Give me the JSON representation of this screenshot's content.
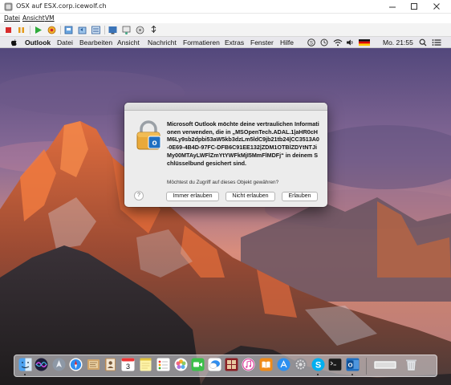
{
  "window": {
    "title": "OSX auf ESX.corp.icewolf.ch",
    "menus": [
      "Datei",
      "Ansicht",
      "VM"
    ]
  },
  "mac_menubar": {
    "apple_icon": "apple-icon",
    "app_name": "Outlook",
    "items": [
      "Datei",
      "Bearbeiten",
      "Ansicht",
      "Nachricht",
      "Formatieren",
      "Extras",
      "Fenster",
      "Hilfe"
    ],
    "clock": "Mo. 21:55"
  },
  "dialog": {
    "message": "Microsoft Outlook möchte deine vertraulichen Informationen verwenden, die in „MSOpenTech.ADAL.1|aHR0cHM6Ly9sb2dpbi53aW5kb3dzLm5ldC9jb21tb24|CC3513A0-0E69-4B4D-97FC-DFB6C91EE132|ZDM1OTBlZDYtNTJiMy00MTAyLWFlZmYtYWFkMjI5MmFlMDFj“ in deinem Schlüsselbund gesichert sind.",
    "question": "Möchtest du Zugriff auf dieses Objekt gewähren?",
    "help": "?",
    "buttons": {
      "always": "Immer erlauben",
      "deny": "Nicht erlauben",
      "allow": "Erlauben"
    }
  },
  "colors": {
    "sky_top": "#5a4e86",
    "sky_glow": "#f09a6a",
    "mountain_lit": "#e2683a",
    "mountain_dark": "#2a2422"
  },
  "dock_icons": [
    "finder",
    "siri",
    "launchpad",
    "safari",
    "mail-stamp",
    "contacts",
    "calendar",
    "notes",
    "reminders",
    "photos",
    "facetime",
    "messages",
    "photo-booth",
    "itunes",
    "ibooks",
    "app-store",
    "system-preferences",
    "skype",
    "terminal",
    "outlook",
    "separator",
    "keyboard",
    "trash"
  ],
  "calendar_day": "3"
}
